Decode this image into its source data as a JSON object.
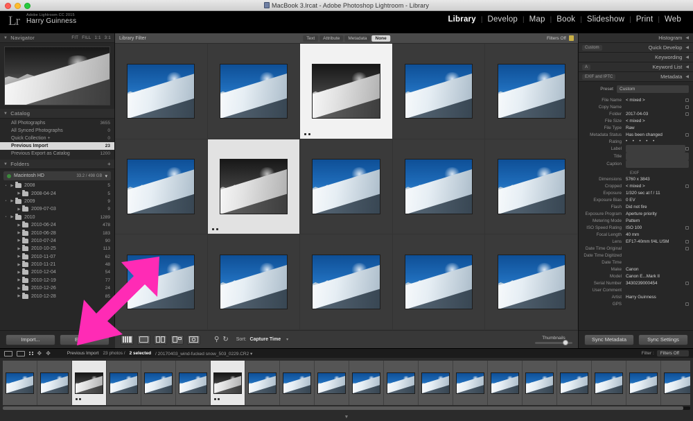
{
  "window": {
    "title": "MacBook 3.lrcat - Adobe Photoshop Lightroom - Library",
    "doc_icon": "document-icon"
  },
  "identity": {
    "logo": "Lr",
    "product": "Adobe Lightroom CC 2015",
    "user": "Harry Guinness"
  },
  "modules": [
    {
      "label": "Library",
      "active": true
    },
    {
      "label": "Develop",
      "active": false
    },
    {
      "label": "Map",
      "active": false
    },
    {
      "label": "Book",
      "active": false
    },
    {
      "label": "Slideshow",
      "active": false
    },
    {
      "label": "Print",
      "active": false
    },
    {
      "label": "Web",
      "active": false
    }
  ],
  "module_separator": "|",
  "left_panel": {
    "navigator": {
      "title": "Navigator",
      "zooms": [
        "FIT",
        "FILL",
        "1:1",
        "3:1"
      ]
    },
    "catalog": {
      "title": "Catalog",
      "items": [
        {
          "label": "All Photographs",
          "count": "3655",
          "selected": false
        },
        {
          "label": "All Synced Photographs",
          "count": "0",
          "selected": false
        },
        {
          "label": "Quick Collection +",
          "count": "0",
          "selected": false
        },
        {
          "label": "Previous Import",
          "count": "23",
          "selected": true
        },
        {
          "label": "Previous Export as Catalog",
          "count": "1200",
          "selected": false
        }
      ]
    },
    "folders": {
      "title": "Folders",
      "plus": "+",
      "volume": {
        "name": "Macintosh HD",
        "info": "33.2 / 498 GB"
      },
      "items": [
        {
          "label": "2008",
          "count": "5",
          "depth": 0
        },
        {
          "label": "2008-04-24",
          "count": "5",
          "depth": 1
        },
        {
          "label": "2009",
          "count": "9",
          "depth": 0
        },
        {
          "label": "2009-07-03",
          "count": "9",
          "depth": 1
        },
        {
          "label": "2010",
          "count": "1289",
          "depth": 0
        },
        {
          "label": "2010-06-24",
          "count": "478",
          "depth": 1
        },
        {
          "label": "2010-06-28",
          "count": "183",
          "depth": 1
        },
        {
          "label": "2010-07-24",
          "count": "90",
          "depth": 1
        },
        {
          "label": "2010-10-25",
          "count": "113",
          "depth": 1
        },
        {
          "label": "2010-11-07",
          "count": "62",
          "depth": 1
        },
        {
          "label": "2010-11-21",
          "count": "48",
          "depth": 1
        },
        {
          "label": "2010-12-04",
          "count": "54",
          "depth": 1
        },
        {
          "label": "2010-12-19",
          "count": "77",
          "depth": 1
        },
        {
          "label": "2010-12-26",
          "count": "24",
          "depth": 1
        },
        {
          "label": "2010-12-28",
          "count": "85",
          "depth": 1
        }
      ]
    },
    "buttons": [
      {
        "label": "Import..."
      },
      {
        "label": "Export..."
      }
    ]
  },
  "filter_bar": {
    "title": "Library Filter",
    "tabs": [
      {
        "label": "Text",
        "active": false
      },
      {
        "label": "Attribute",
        "active": false
      },
      {
        "label": "Metadata",
        "active": false
      },
      {
        "label": "None",
        "active": true
      }
    ],
    "right_label": "Filters Off",
    "lock_icon": "lock-icon"
  },
  "grid": {
    "cells": [
      {
        "index": 1,
        "state": "normal"
      },
      {
        "index": 2,
        "state": "normal"
      },
      {
        "index": 3,
        "state": "active"
      },
      {
        "index": 4,
        "state": "normal"
      },
      {
        "index": 5,
        "state": "normal"
      },
      {
        "index": 6,
        "state": "normal"
      },
      {
        "index": 7,
        "state": "selected"
      },
      {
        "index": 8,
        "state": "normal"
      },
      {
        "index": 9,
        "state": "normal"
      },
      {
        "index": 10,
        "state": "normal"
      },
      {
        "index": 11,
        "state": "normal"
      },
      {
        "index": 12,
        "state": "normal"
      },
      {
        "index": 13,
        "state": "normal"
      },
      {
        "index": 14,
        "state": "normal"
      },
      {
        "index": 15,
        "state": "normal"
      }
    ]
  },
  "grid_toolbar": {
    "view_buttons": [
      {
        "name": "grid-view-icon"
      },
      {
        "name": "loupe-view-icon"
      },
      {
        "name": "compare-view-icon"
      },
      {
        "name": "survey-view-icon"
      },
      {
        "name": "people-view-icon"
      }
    ],
    "painter_icon": "spray-can-icon",
    "rotate_icon": "rotate-icon",
    "sort_label": "Sort:",
    "sort_value": "Capture Time",
    "thumbnails_label": "Thumbnails"
  },
  "right_panel": {
    "sections": [
      {
        "label": "Histogram",
        "left": ""
      },
      {
        "label": "Quick Develop",
        "left": "Custom"
      },
      {
        "label": "Keywording",
        "left": ""
      },
      {
        "label": "Keyword List",
        "left": "A"
      },
      {
        "label": "Metadata",
        "left": "EXIF and IPTC"
      }
    ],
    "preset": {
      "label": "Preset",
      "value": "Custom"
    },
    "fields": [
      {
        "key": "File Name",
        "value": "< mixed >",
        "has_action": true
      },
      {
        "key": "Copy Name",
        "value": "",
        "has_action": true
      },
      {
        "key": "Folder",
        "value": "2017-04-03",
        "has_action": true
      },
      {
        "key": "File Size",
        "value": "< mixed >",
        "has_action": false
      },
      {
        "key": "File Type",
        "value": "Raw",
        "has_action": false
      },
      {
        "key": "Metadata Status",
        "value": "Has been changed",
        "has_action": true
      },
      {
        "key": "Rating",
        "value": "",
        "stars": "• • • • •",
        "has_action": false
      },
      {
        "key": "Label",
        "value": "",
        "is_box": true,
        "has_action": true
      },
      {
        "key": "Title",
        "value": "",
        "is_box": true,
        "has_action": false
      },
      {
        "key": "Caption",
        "value": "",
        "is_box": true,
        "has_action": false
      }
    ],
    "exif_label": "EXIF",
    "exif": [
      {
        "key": "Dimensions",
        "value": "5760 x 3843",
        "has_action": false
      },
      {
        "key": "Cropped",
        "value": "< mixed >",
        "has_action": true
      },
      {
        "key": "Exposure",
        "value": "1/320 sec at f / 11",
        "has_action": false
      },
      {
        "key": "Exposure Bias",
        "value": "0 EV",
        "has_action": false
      },
      {
        "key": "Flash",
        "value": "Did not fire",
        "has_action": false
      },
      {
        "key": "Exposure Program",
        "value": "Aperture priority",
        "has_action": false
      },
      {
        "key": "Metering Mode",
        "value": "Pattern",
        "has_action": false
      },
      {
        "key": "ISO Speed Rating",
        "value": "ISO 100",
        "has_action": true
      },
      {
        "key": "Focal Length",
        "value": "40 mm",
        "has_action": false
      },
      {
        "key": "Lens",
        "value": "EF17-40mm f/4L USM",
        "has_action": true
      },
      {
        "key": "Date Time Original",
        "value": "",
        "has_action": true
      },
      {
        "key": "Date Time Digitized",
        "value": "",
        "has_action": false
      },
      {
        "key": "Date Time",
        "value": "",
        "has_action": false
      },
      {
        "key": "Make",
        "value": "Canon",
        "has_action": false
      },
      {
        "key": "Model",
        "value": "Canon E...Mark II",
        "has_action": false
      },
      {
        "key": "Serial Number",
        "value": "3430239000454",
        "has_action": true
      },
      {
        "key": "User Comment",
        "value": "",
        "has_action": false
      },
      {
        "key": "Artist",
        "value": "Harry Guinness",
        "has_action": false
      },
      {
        "key": "GPS",
        "value": "",
        "has_action": true
      }
    ],
    "buttons": [
      {
        "label": "Sync Metadata"
      },
      {
        "label": "Sync Settings"
      }
    ]
  },
  "status_bar": {
    "icons": [
      "grid-view-icon",
      "loupe-view-icon",
      "thumb-size-icon",
      "rotate-left-icon",
      "rotate-right-icon"
    ],
    "source": "Previous Import",
    "photo_count": "23 photos /",
    "selected": "2 selected",
    "filename": "/ 20170403_wind-fucked snow_503_0229.CR2  ▾",
    "filter_label": "Filter :",
    "filter_value": "Filters Off"
  },
  "filmstrip": {
    "cells": [
      {
        "index": 1,
        "selected": false
      },
      {
        "index": 2,
        "selected": false
      },
      {
        "index": 3,
        "selected": true
      },
      {
        "index": 4,
        "selected": false
      },
      {
        "index": 5,
        "selected": false
      },
      {
        "index": 6,
        "selected": false
      },
      {
        "index": 7,
        "selected": true
      },
      {
        "index": 8,
        "selected": false
      },
      {
        "index": 9,
        "selected": false
      },
      {
        "index": 10,
        "selected": false
      },
      {
        "index": 11,
        "selected": false
      },
      {
        "index": 12,
        "selected": false
      },
      {
        "index": 13,
        "selected": false
      },
      {
        "index": 14,
        "selected": false
      },
      {
        "index": 15,
        "selected": false
      },
      {
        "index": 16,
        "selected": false
      },
      {
        "index": 17,
        "selected": false
      },
      {
        "index": 18,
        "selected": false
      },
      {
        "index": 19,
        "selected": false
      },
      {
        "index": 20,
        "selected": false
      }
    ],
    "collapse_arrow": "▼"
  },
  "annotation": {
    "arrow_color": "#ff2bb5",
    "name": "pink-arrow-pointer"
  }
}
